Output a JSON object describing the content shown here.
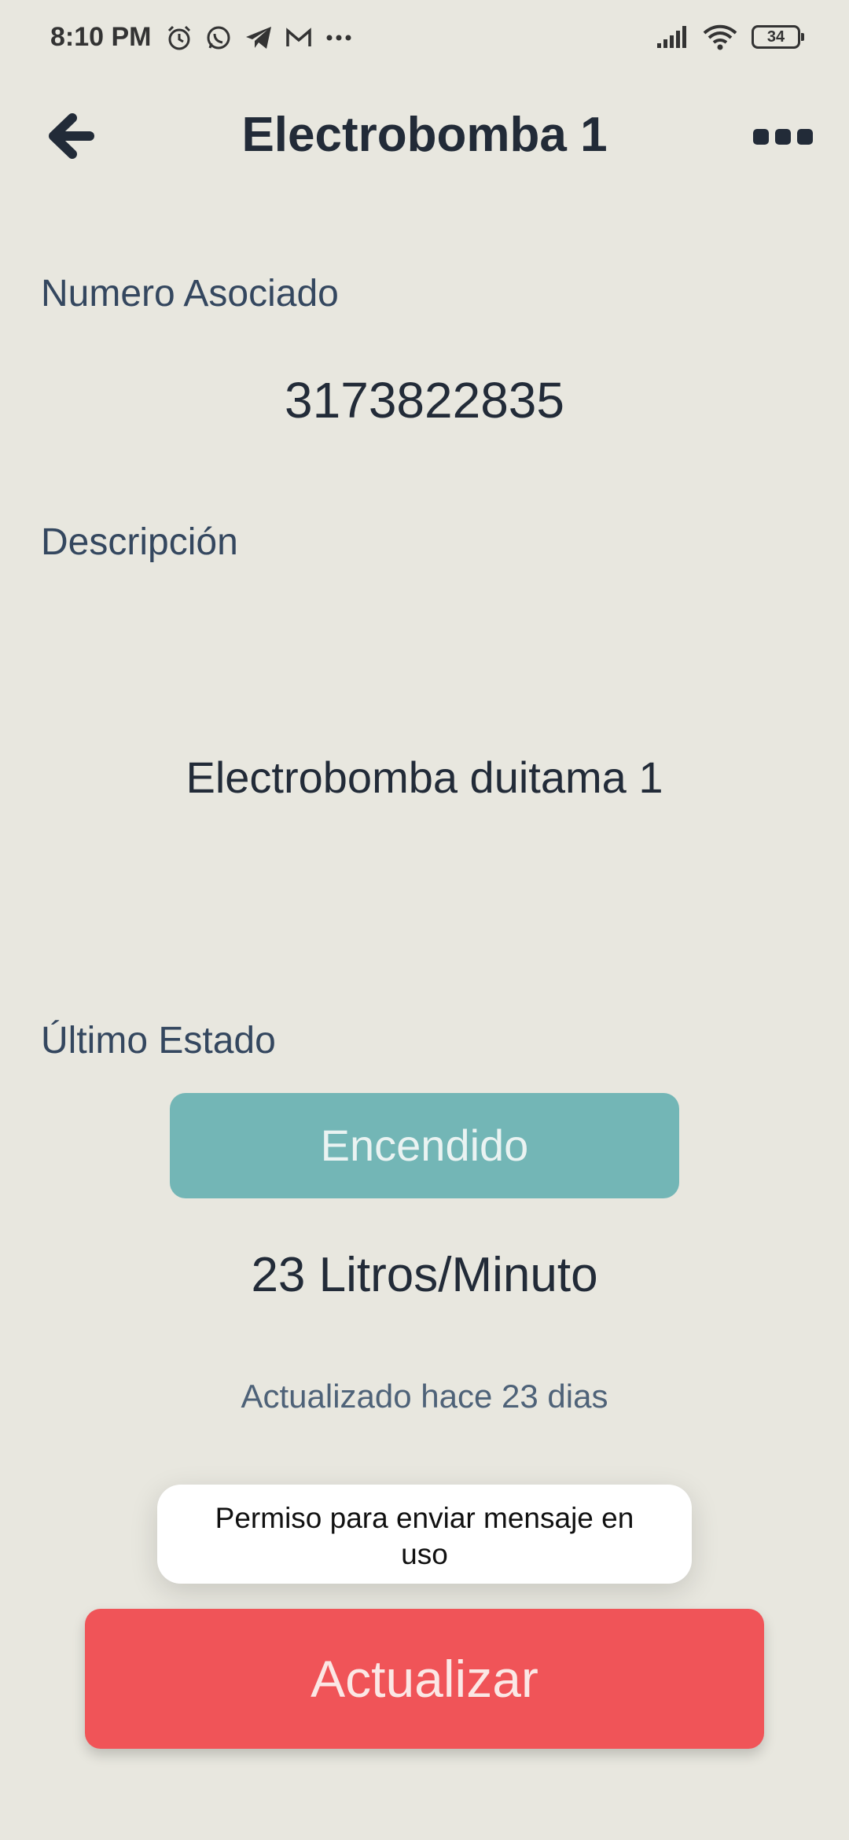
{
  "status_bar": {
    "time": "8:10 PM",
    "left_icons": [
      "alarm-icon",
      "whatsapp-icon",
      "telegram-icon",
      "gmail-icon",
      "more-notifications-icon"
    ],
    "right_icons": [
      "signal-icon",
      "wifi-icon"
    ],
    "battery_level": "34"
  },
  "app_bar": {
    "title": "Electrobomba 1",
    "back_icon": "back-arrow-icon",
    "menu_icon": "more-options-icon"
  },
  "fields": {
    "associated_number_label": "Numero Asociado",
    "associated_number_value": "3173822835",
    "description_label": "Descripción",
    "description_value": "Electrobomba duitama 1",
    "last_status_label": "Último Estado",
    "last_status_value": "Encendido",
    "flow_value": "23 Litros/Minuto",
    "updated_text": "Actualizado hace 23 dias"
  },
  "toast": {
    "message": "Permiso para enviar mensaje en uso"
  },
  "actions": {
    "update_label": "Actualizar"
  },
  "colors": {
    "background": "#e8e7df",
    "status_pill": "#73b6b6",
    "update_button": "#f05458",
    "label_text": "#34475f"
  }
}
